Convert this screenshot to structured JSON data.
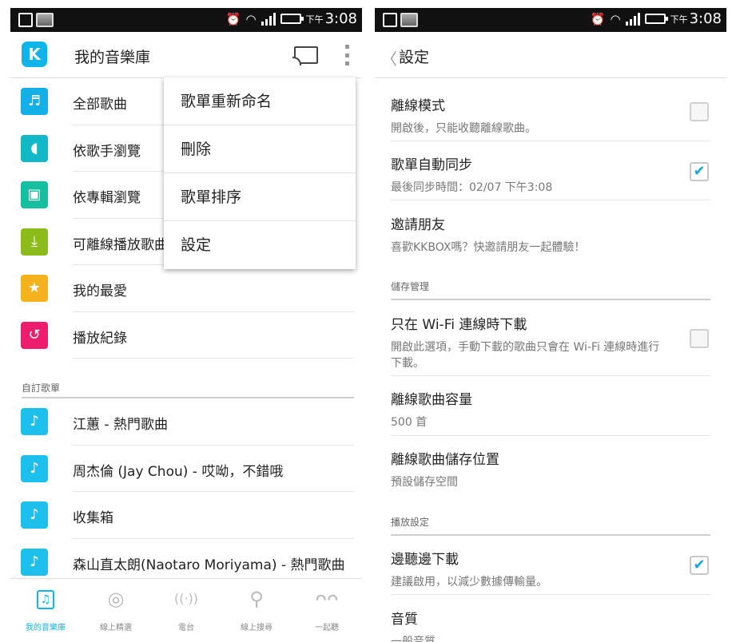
{
  "status_bar": {
    "ampm": "下午",
    "time": "3:08"
  },
  "library": {
    "title": "我的音樂庫",
    "items": [
      {
        "label": "全部歌曲",
        "icon": "trash-music-icon",
        "color": "#12b0e6"
      },
      {
        "label": "依歌手瀏覽",
        "icon": "artist-icon",
        "color": "#12b8c8"
      },
      {
        "label": "依專輯瀏覽",
        "icon": "album-icon",
        "color": "#14bfa0"
      },
      {
        "label": "可離線播放歌曲",
        "icon": "download-icon",
        "color": "#8cbc1c"
      },
      {
        "label": "我的最愛",
        "icon": "star-icon",
        "color": "#f6b21c"
      },
      {
        "label": "播放紀錄",
        "icon": "history-icon",
        "color": "#ee1c6c"
      }
    ],
    "custom_header": "自訂歌單",
    "playlists": [
      {
        "label": "江蕙 - 熱門歌曲"
      },
      {
        "label": "周杰倫 (Jay Chou) - 哎呦，不錯哦"
      },
      {
        "label": "收集箱"
      },
      {
        "label": "森山直太朗(Naotaro Moriyama) - 熱門歌曲"
      }
    ],
    "playlist_color": "#1cc0ea"
  },
  "menu": {
    "items": [
      {
        "label": "歌單重新命名"
      },
      {
        "label": "刪除"
      },
      {
        "label": "歌單排序"
      },
      {
        "label": "設定"
      }
    ]
  },
  "bottom_nav": {
    "tabs": [
      {
        "label": "我的音樂庫",
        "active": true
      },
      {
        "label": "線上精選",
        "active": false
      },
      {
        "label": "電台",
        "active": false
      },
      {
        "label": "線上搜尋",
        "active": false
      },
      {
        "label": "一起聽",
        "active": false
      }
    ],
    "accent": "#0fb4e8"
  },
  "settings": {
    "title": "設定",
    "rows": [
      {
        "title": "離線模式",
        "subtitle": "開啟後，只能收聽離線歌曲。",
        "checked": false
      },
      {
        "title": "歌單自動同步",
        "subtitle": "最後同步時間：02/07 下午3:08",
        "checked": true
      },
      {
        "title": "邀請朋友",
        "subtitle": "喜歡KKBOX嗎？快邀請朋友一起體驗！"
      }
    ],
    "storage_header": "儲存管理",
    "storage_rows": [
      {
        "title": "只在 Wi-Fi 連線時下載",
        "subtitle": "開啟此選項，手動下載的歌曲只會在 Wi-Fi 連線時進行下載。",
        "checked": false
      },
      {
        "title": "離線歌曲容量",
        "subtitle": "500 首"
      },
      {
        "title": "離線歌曲儲存位置",
        "subtitle": "預設儲存空間"
      }
    ],
    "playback_header": "播放設定",
    "playback_rows": [
      {
        "title": "邊聽邊下載",
        "subtitle": "建議啟用，以減少數據傳輸量。",
        "checked": true
      },
      {
        "title": "音質",
        "subtitle": "一般音質"
      }
    ]
  }
}
